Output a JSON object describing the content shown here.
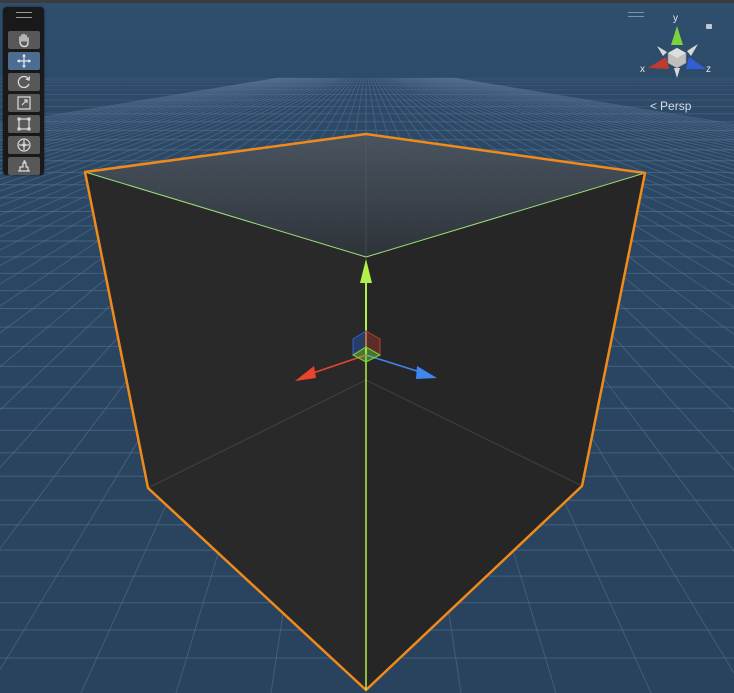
{
  "window": {
    "name": "scene-view"
  },
  "toolbar": {
    "tools": [
      {
        "id": "hand",
        "icon": "hand-icon",
        "active": false
      },
      {
        "id": "move",
        "icon": "move-icon",
        "active": true
      },
      {
        "id": "rotate",
        "icon": "rotate-icon",
        "active": false
      },
      {
        "id": "scale",
        "icon": "scale-icon",
        "active": false
      },
      {
        "id": "rect",
        "icon": "rect-transform-icon",
        "active": false
      },
      {
        "id": "transform",
        "icon": "transform-icon",
        "active": false
      },
      {
        "id": "custom",
        "icon": "custom-tool-icon",
        "active": false
      }
    ]
  },
  "gizmo": {
    "x_label": "x",
    "y_label": "y",
    "z_label": "z",
    "projection_label": "Persp",
    "colors": {
      "x": "#c23a2e",
      "y": "#7ad33c",
      "z": "#2e5fd6"
    }
  },
  "scene": {
    "background": "#2b4764",
    "selection_outline": "#f08a1a",
    "cube_face": "#2a2a2a",
    "handle_colors": {
      "x": "#e8452f",
      "y": "#b3ef4a",
      "z": "#3f86f0"
    }
  }
}
